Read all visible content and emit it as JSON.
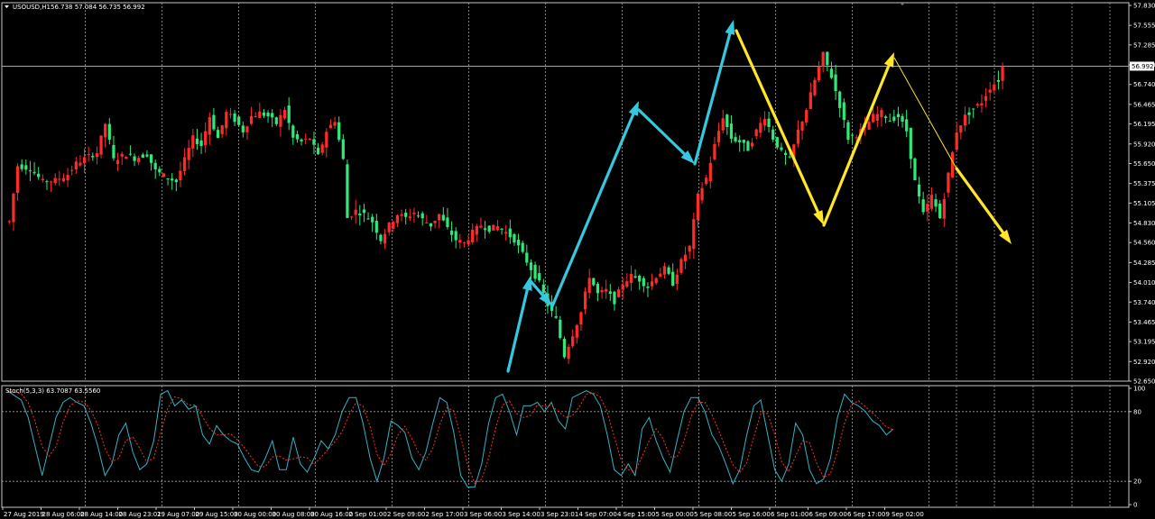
{
  "header": {
    "symbol_label": "USOUSD,H1",
    "ohlc_label": "56.738 57.084 56.735 56.992"
  },
  "stoch_header": {
    "label": "Stoch(5,3,3) 63.7087 63.5560"
  },
  "colors": {
    "background": "#000000",
    "bull": "#ff2a2a",
    "bear": "#2ee87a",
    "grid": "#a0a0a0",
    "frame": "#c8c8c8",
    "cyan_arrow": "#35c8de",
    "yellow_arrow": "#ffe629",
    "stoch_main": "#33b3c6",
    "stoch_signal": "#ff3030"
  },
  "chart_data": [
    {
      "type": "candlestick",
      "title": "",
      "ylim": [
        52.65,
        57.83
      ],
      "ylabels": [
        "57.830",
        "57.555",
        "57.285",
        "57.010",
        "56.740",
        "56.465",
        "56.195",
        "55.920",
        "55.650",
        "55.375",
        "55.105",
        "54.830",
        "54.560",
        "54.285",
        "54.010",
        "53.740",
        "53.465",
        "53.195",
        "52.920",
        "52.650"
      ],
      "current_price": 56.992,
      "current_price_label": "56.992",
      "x_labels": [
        "27 Aug 2019",
        "28 Aug 06:00",
        "28 Aug 14:00",
        "28 Aug 23:01",
        "29 Aug 07:00",
        "29 Aug 15:00",
        "30 Aug 00:00",
        "30 Aug 08:00",
        "30 Aug 16:00",
        "2 Sep 01:00",
        "2 Sep 09:00",
        "2 Sep 17:00",
        "3 Sep 06:00",
        "3 Sep 14:00",
        "3 Sep 23:01",
        "4 Sep 07:00",
        "4 Sep 15:00",
        "5 Sep 00:00",
        "5 Sep 08:00",
        "5 Sep 16:00",
        "6 Sep 01:00",
        "6 Sep 09:00",
        "6 Sep 17:00",
        "9 Sep 02:00"
      ],
      "close_path": [
        [
          0,
          54.85
        ],
        [
          2,
          55.62
        ],
        [
          5,
          55.58
        ],
        [
          8,
          55.4
        ],
        [
          11,
          55.42
        ],
        [
          14,
          55.5
        ],
        [
          16,
          55.65
        ],
        [
          19,
          55.75
        ],
        [
          21,
          55.8
        ],
        [
          23,
          56.2
        ],
        [
          25,
          55.7
        ],
        [
          28,
          55.78
        ],
        [
          30,
          55.72
        ],
        [
          33,
          55.78
        ],
        [
          35,
          55.55
        ],
        [
          38,
          55.45
        ],
        [
          40,
          55.4
        ],
        [
          42,
          55.7
        ],
        [
          44,
          56.0
        ],
        [
          46,
          55.9
        ],
        [
          48,
          56.3
        ],
        [
          50,
          56.0
        ],
        [
          52,
          56.35
        ],
        [
          54,
          56.25
        ],
        [
          56,
          56.1
        ],
        [
          58,
          56.3
        ],
        [
          60,
          56.35
        ],
        [
          62,
          56.3
        ],
        [
          64,
          56.2
        ],
        [
          66,
          56.4
        ],
        [
          68,
          56.0
        ],
        [
          70,
          55.95
        ],
        [
          72,
          56.0
        ],
        [
          74,
          55.75
        ],
        [
          76,
          56.1
        ],
        [
          78,
          56.25
        ],
        [
          80,
          55.7
        ],
        [
          81,
          54.9
        ],
        [
          83,
          55.0
        ],
        [
          85,
          54.95
        ],
        [
          87,
          54.85
        ],
        [
          89,
          54.6
        ],
        [
          91,
          54.8
        ],
        [
          93,
          54.95
        ],
        [
          95,
          54.9
        ],
        [
          97,
          54.98
        ],
        [
          99,
          54.88
        ],
        [
          101,
          54.8
        ],
        [
          103,
          54.95
        ],
        [
          105,
          54.75
        ],
        [
          107,
          54.6
        ],
        [
          109,
          54.55
        ],
        [
          111,
          54.7
        ],
        [
          113,
          54.8
        ],
        [
          115,
          54.75
        ],
        [
          117,
          54.78
        ],
        [
          119,
          54.7
        ],
        [
          121,
          54.6
        ],
        [
          123,
          54.4
        ],
        [
          125,
          54.2
        ],
        [
          127,
          54.0
        ],
        [
          129,
          53.7
        ],
        [
          131,
          53.5
        ],
        [
          133,
          53.0
        ],
        [
          135,
          53.3
        ],
        [
          137,
          53.6
        ],
        [
          139,
          54.1
        ],
        [
          141,
          53.85
        ],
        [
          143,
          53.9
        ],
        [
          145,
          53.75
        ],
        [
          147,
          54.0
        ],
        [
          149,
          54.1
        ],
        [
          151,
          54.05
        ],
        [
          153,
          53.95
        ],
        [
          155,
          54.1
        ],
        [
          157,
          54.2
        ],
        [
          159,
          54.0
        ],
        [
          161,
          54.3
        ],
        [
          163,
          54.5
        ],
        [
          165,
          55.2
        ],
        [
          167,
          55.45
        ],
        [
          169,
          55.9
        ],
        [
          171,
          56.3
        ],
        [
          173,
          56.0
        ],
        [
          175,
          55.95
        ],
        [
          177,
          55.85
        ],
        [
          179,
          56.1
        ],
        [
          181,
          56.3
        ],
        [
          183,
          56.0
        ],
        [
          185,
          55.8
        ],
        [
          187,
          55.7
        ],
        [
          189,
          56.1
        ],
        [
          191,
          56.4
        ],
        [
          193,
          56.8
        ],
        [
          195,
          57.15
        ],
        [
          197,
          56.85
        ],
        [
          199,
          56.45
        ],
        [
          201,
          56.0
        ],
        [
          203,
          56.05
        ],
        [
          205,
          56.15
        ],
        [
          207,
          56.3
        ],
        [
          209,
          56.35
        ],
        [
          211,
          56.25
        ],
        [
          213,
          56.3
        ],
        [
          215,
          56.1
        ],
        [
          217,
          55.4
        ],
        [
          219,
          54.95
        ],
        [
          221,
          55.2
        ],
        [
          223,
          54.9
        ],
        [
          225,
          55.5
        ],
        [
          227,
          56.1
        ],
        [
          229,
          56.3
        ],
        [
          231,
          56.4
        ],
        [
          233,
          56.5
        ],
        [
          235,
          56.7
        ],
        [
          237,
          56.8
        ],
        [
          238,
          56.99
        ]
      ]
    },
    {
      "type": "line",
      "title": "",
      "ylim": [
        0,
        100
      ],
      "ylabels": [
        "100",
        "80",
        "20",
        "0"
      ],
      "series_main": [
        [
          0,
          98
        ],
        [
          4,
          90
        ],
        [
          6,
          75
        ],
        [
          8,
          50
        ],
        [
          10,
          25
        ],
        [
          12,
          50
        ],
        [
          14,
          75
        ],
        [
          16,
          88
        ],
        [
          18,
          92
        ],
        [
          20,
          88
        ],
        [
          22,
          85
        ],
        [
          24,
          70
        ],
        [
          26,
          50
        ],
        [
          28,
          25
        ],
        [
          30,
          35
        ],
        [
          32,
          60
        ],
        [
          34,
          70
        ],
        [
          36,
          45
        ],
        [
          38,
          30
        ],
        [
          40,
          35
        ],
        [
          42,
          55
        ],
        [
          44,
          95
        ],
        [
          46,
          98
        ],
        [
          48,
          85
        ],
        [
          50,
          90
        ],
        [
          52,
          82
        ],
        [
          54,
          85
        ],
        [
          56,
          60
        ],
        [
          58,
          52
        ],
        [
          60,
          68
        ],
        [
          62,
          60
        ],
        [
          64,
          55
        ],
        [
          66,
          52
        ],
        [
          68,
          40
        ],
        [
          70,
          30
        ],
        [
          72,
          28
        ],
        [
          74,
          40
        ],
        [
          76,
          55
        ],
        [
          78,
          30
        ],
        [
          80,
          30
        ],
        [
          82,
          58
        ],
        [
          84,
          35
        ],
        [
          86,
          28
        ],
        [
          88,
          40
        ],
        [
          90,
          55
        ],
        [
          92,
          48
        ],
        [
          94,
          60
        ],
        [
          96,
          80
        ],
        [
          98,
          92
        ],
        [
          100,
          92
        ],
        [
          102,
          70
        ],
        [
          104,
          40
        ],
        [
          106,
          20
        ],
        [
          108,
          40
        ],
        [
          110,
          72
        ],
        [
          112,
          68
        ],
        [
          114,
          62
        ],
        [
          116,
          40
        ],
        [
          118,
          30
        ],
        [
          120,
          45
        ],
        [
          122,
          70
        ],
        [
          124,
          92
        ],
        [
          126,
          88
        ],
        [
          128,
          62
        ],
        [
          130,
          25
        ],
        [
          132,
          15
        ],
        [
          134,
          15
        ],
        [
          136,
          35
        ],
        [
          138,
          70
        ],
        [
          140,
          92
        ],
        [
          142,
          95
        ],
        [
          144,
          80
        ],
        [
          146,
          60
        ],
        [
          148,
          85
        ],
        [
          150,
          85
        ],
        [
          152,
          88
        ],
        [
          154,
          80
        ],
        [
          156,
          88
        ],
        [
          158,
          72
        ],
        [
          160,
          65
        ],
        [
          162,
          92
        ],
        [
          164,
          95
        ],
        [
          166,
          98
        ],
        [
          168,
          95
        ],
        [
          170,
          85
        ],
        [
          172,
          60
        ],
        [
          174,
          30
        ],
        [
          176,
          25
        ],
        [
          178,
          35
        ],
        [
          180,
          25
        ],
        [
          182,
          65
        ],
        [
          184,
          75
        ],
        [
          186,
          55
        ],
        [
          188,
          40
        ],
        [
          190,
          28
        ],
        [
          192,
          55
        ],
        [
          194,
          80
        ],
        [
          196,
          92
        ],
        [
          198,
          92
        ],
        [
          200,
          80
        ],
        [
          202,
          60
        ],
        [
          204,
          50
        ],
        [
          206,
          35
        ],
        [
          208,
          18
        ],
        [
          210,
          30
        ],
        [
          212,
          60
        ],
        [
          214,
          85
        ],
        [
          216,
          90
        ],
        [
          218,
          60
        ],
        [
          220,
          30
        ],
        [
          222,
          20
        ],
        [
          224,
          35
        ],
        [
          226,
          70
        ],
        [
          228,
          60
        ],
        [
          230,
          30
        ],
        [
          232,
          18
        ],
        [
          234,
          22
        ],
        [
          236,
          40
        ],
        [
          238,
          75
        ],
        [
          240,
          95
        ],
        [
          242,
          88
        ],
        [
          244,
          85
        ],
        [
          246,
          80
        ],
        [
          248,
          72
        ],
        [
          250,
          68
        ],
        [
          252,
          60
        ],
        [
          254,
          65
        ]
      ]
    }
  ]
}
